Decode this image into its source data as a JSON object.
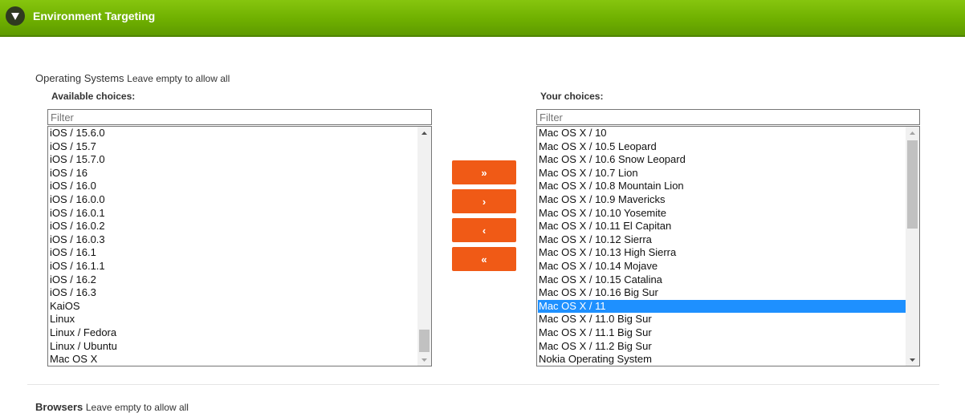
{
  "header": {
    "title": "Environment Targeting"
  },
  "operating_systems": {
    "title": "Operating Systems",
    "hint": "Leave empty to allow all",
    "available": {
      "label": "Available choices:",
      "filter_placeholder": "Filter",
      "items": [
        "iOS / 15.6.0",
        "iOS / 15.7",
        "iOS / 15.7.0",
        "iOS / 16",
        "iOS / 16.0",
        "iOS / 16.0.0",
        "iOS / 16.0.1",
        "iOS / 16.0.2",
        "iOS / 16.0.3",
        "iOS / 16.1",
        "iOS / 16.1.1",
        "iOS / 16.2",
        "iOS / 16.3",
        "KaiOS",
        "Linux",
        "Linux / Fedora",
        "Linux / Ubuntu",
        "Mac OS X"
      ]
    },
    "chosen": {
      "label": "Your choices:",
      "filter_placeholder": "Filter",
      "selected_item": "Mac OS X / 11",
      "items": [
        "Mac OS X / 10",
        "Mac OS X / 10.5 Leopard",
        "Mac OS X / 10.6 Snow Leopard",
        "Mac OS X / 10.7 Lion",
        "Mac OS X / 10.8 Mountain Lion",
        "Mac OS X / 10.9 Mavericks",
        "Mac OS X / 10.10 Yosemite",
        "Mac OS X / 10.11 El Capitan",
        "Mac OS X / 10.12 Sierra",
        "Mac OS X / 10.13 High Sierra",
        "Mac OS X / 10.14 Mojave",
        "Mac OS X / 10.15 Catalina",
        "Mac OS X / 10.16 Big Sur",
        "Mac OS X / 11",
        "Mac OS X / 11.0 Big Sur",
        "Mac OS X / 11.1 Big Sur",
        "Mac OS X / 11.2 Big Sur",
        "Nokia Operating System"
      ]
    },
    "buttons": {
      "add_all": "»",
      "add": "›",
      "remove": "‹",
      "remove_all": "«"
    }
  },
  "browsers": {
    "title": "Browsers",
    "hint": "Leave empty to allow all"
  },
  "colors": {
    "header_green": "#6fb000",
    "button_orange": "#f05a16",
    "selection_blue": "#1e90ff"
  }
}
